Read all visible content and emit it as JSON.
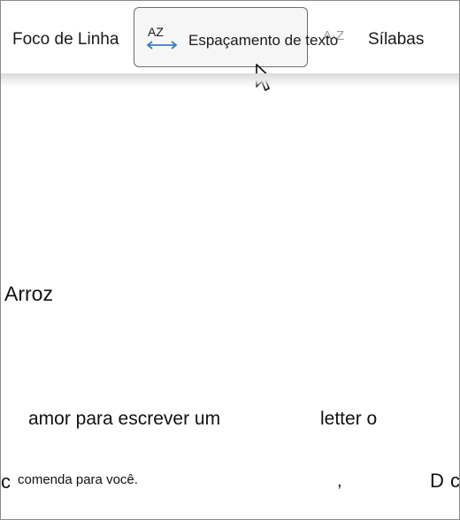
{
  "toolbar": {
    "line_focus_label": "Foco de Linha",
    "text_spacing": {
      "icon_text": "AZ",
      "label": "Espaçamento de texto"
    },
    "syllables": {
      "icon_text": "A·Z",
      "label": "Sílabas"
    }
  },
  "document": {
    "word_title": "Arroz",
    "line1_part1": "amor para escrever um",
    "line1_part2": "letter o",
    "line2_letter_c": "c",
    "line2_text": "comenda para você.",
    "line2_comma": ",",
    "line2_d": "D",
    "line2_c_end": "c"
  },
  "colors": {
    "spacing_icon_accent": "#3a7fc1",
    "selected_button_border": "#6e6e6e",
    "selected_button_bg": "#f6f6f6"
  },
  "icons": [
    "az-spacing-icon",
    "syllable-icon",
    "mouse-cursor-icon"
  ]
}
